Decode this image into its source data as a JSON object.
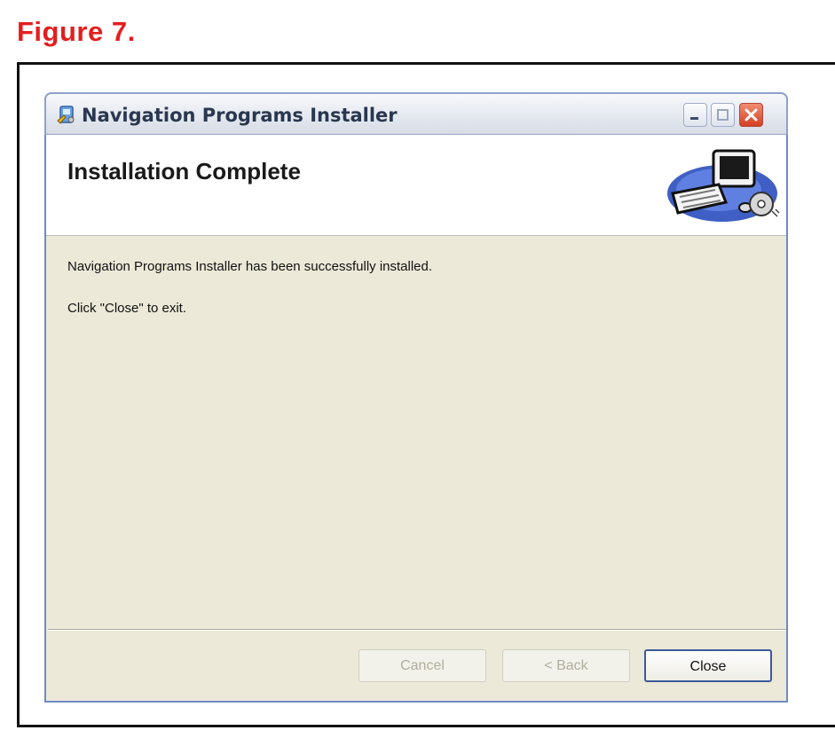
{
  "figure": {
    "caption": "Figure 7."
  },
  "window": {
    "title": "Navigation Programs Installer",
    "icon": "installer-icon",
    "controls": {
      "minimize": "minimize-icon",
      "maximize": "maximize-icon",
      "close": "close-icon"
    }
  },
  "header": {
    "title": "Installation Complete",
    "graphic": "computer-cd-icon"
  },
  "body": {
    "line1": "Navigation Programs Installer has been successfully installed.",
    "line2": "Click \"Close\" to exit."
  },
  "buttons": {
    "cancel": "Cancel",
    "back": "< Back",
    "close": "Close"
  },
  "colors": {
    "caption": "#e41e1e",
    "dialog_bg": "#ece9d8",
    "close_button_border": "#3c5a9a"
  }
}
